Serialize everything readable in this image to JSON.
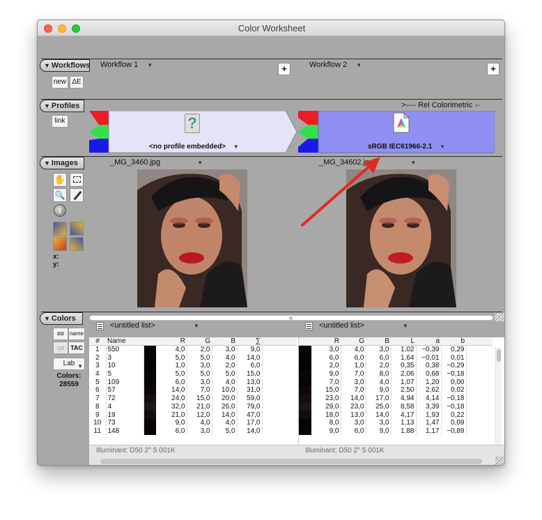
{
  "window": {
    "title": "Color Worksheet",
    "traffic_colors": [
      "#fe5f57",
      "#febc2e",
      "#28c840"
    ]
  },
  "sections": {
    "workflows": "Workflows",
    "profiles": "Profiles",
    "images": "Images",
    "colors": "Colors"
  },
  "workflows": {
    "new_label": "new",
    "delta_e_label": "ΔE",
    "workflow1": "Workflow 1",
    "workflow2": "Workflow 2",
    "add_glyph": "+"
  },
  "profiles": {
    "link_label": "link",
    "rendering_intent": ">---- Rel Colorimetric --",
    "left_profile": "<no profile embedded>",
    "right_profile": "sRGB IEC61966-2.1",
    "left_fill": "#e4e4f8",
    "right_fill": "#9090f2"
  },
  "images": {
    "left_file": "_MG_3460.jpg",
    "right_file": "_MG_34602.jpg",
    "x_label": "x:",
    "y_label": "y:"
  },
  "colors": {
    "hash_label": "##",
    "name_label": "name",
    "rpt_label": "rpt",
    "tac_label": "TAC",
    "lab_label": "Lab",
    "count_label": "Colors:",
    "count_value": "28559",
    "left_list": "<untitled list>",
    "right_list": "<untitled list>",
    "left_headers": [
      "#",
      "Name",
      "",
      "R",
      "G",
      "B",
      "∑"
    ],
    "right_headers": [
      "",
      "R",
      "G",
      "B",
      "L",
      "a",
      "b"
    ],
    "rows": [
      {
        "n": "1",
        "name": "550",
        "sw": "#060403",
        "R": "4,0",
        "G": "2,0",
        "B": "3,0",
        "S": "9,0",
        "sw2": "#040304",
        "R2": "3,0",
        "G2": "4,0",
        "B2": "3,0",
        "L": "1,02",
        "a": "−0,39",
        "b": "0,29"
      },
      {
        "n": "2",
        "name": "3",
        "sw": "#070605",
        "R": "5,0",
        "G": "5,0",
        "B": "4,0",
        "S": "14,0",
        "sw2": "#060606",
        "R2": "6,0",
        "G2": "6,0",
        "B2": "6,0",
        "L": "1,64",
        "a": "−0,01",
        "b": "0,01"
      },
      {
        "n": "3",
        "name": "10",
        "sw": "#030203",
        "R": "1,0",
        "G": "3,0",
        "B": "2,0",
        "S": "6,0",
        "sw2": "#020102",
        "R2": "2,0",
        "G2": "1,0",
        "B2": "2,0",
        "L": "0,35",
        "a": "0,38",
        "b": "−0,29"
      },
      {
        "n": "4",
        "name": "5",
        "sw": "#070606",
        "R": "5,0",
        "G": "5,0",
        "B": "5,0",
        "S": "15,0",
        "sw2": "#090708",
        "R2": "9,0",
        "G2": "7,0",
        "B2": "8,0",
        "L": "2,06",
        "a": "0,68",
        "b": "−0,18"
      },
      {
        "n": "5",
        "name": "109",
        "sw": "#070504",
        "R": "6,0",
        "G": "3,0",
        "B": "4,0",
        "S": "13,0",
        "sw2": "#070304",
        "R2": "7,0",
        "G2": "3,0",
        "B2": "4,0",
        "L": "1,07",
        "a": "1,20",
        "b": "0,00"
      },
      {
        "n": "6",
        "name": "57",
        "sw": "#0e0709",
        "R": "14,0",
        "G": "7,0",
        "B": "10,0",
        "S": "31,0",
        "sw2": "#0f0709",
        "R2": "15,0",
        "G2": "7,0",
        "B2": "9,0",
        "L": "2,50",
        "a": "2,62",
        "b": "0,02"
      },
      {
        "n": "7",
        "name": "72",
        "sw": "#180f14",
        "R": "24,0",
        "G": "15,0",
        "B": "20,0",
        "S": "59,0",
        "sw2": "#170e11",
        "R2": "23,0",
        "G2": "14,0",
        "B2": "17,0",
        "L": "4,94",
        "a": "4,14",
        "b": "−0,18"
      },
      {
        "n": "8",
        "name": "4",
        "sw": "#20151a",
        "R": "32,0",
        "G": "21,0",
        "B": "26,0",
        "S": "79,0",
        "sw2": "#1d1719",
        "R2": "29,0",
        "G2": "23,0",
        "B2": "25,0",
        "L": "8,58",
        "a": "3,39",
        "b": "−0,18"
      },
      {
        "n": "9",
        "name": "19",
        "sw": "#150c0e",
        "R": "21,0",
        "G": "12,0",
        "B": "14,0",
        "S": "47,0",
        "sw2": "#120d0e",
        "R2": "18,0",
        "G2": "13,0",
        "B2": "14,0",
        "L": "4,17",
        "a": "1,93",
        "b": "0,22"
      },
      {
        "n": "10",
        "name": "73",
        "sw": "#090404",
        "R": "9,0",
        "G": "4,0",
        "B": "4,0",
        "S": "17,0",
        "sw2": "#080303",
        "R2": "8,0",
        "G2": "3,0",
        "B2": "3,0",
        "L": "1,13",
        "a": "1,47",
        "b": "0,09"
      },
      {
        "n": "11",
        "name": "148",
        "sw": "#060305",
        "R": "6,0",
        "G": "3,0",
        "B": "5,0",
        "S": "14,0",
        "sw2": "#090609",
        "R2": "9,0",
        "G2": "6,0",
        "B2": "9,0",
        "L": "1,88",
        "a": "1,17",
        "b": "−0,89"
      }
    ],
    "left_illuminant": "Illuminant: D50 2° 5 001K",
    "right_illuminant": "Illuminant: D50 2° 5 001K"
  }
}
